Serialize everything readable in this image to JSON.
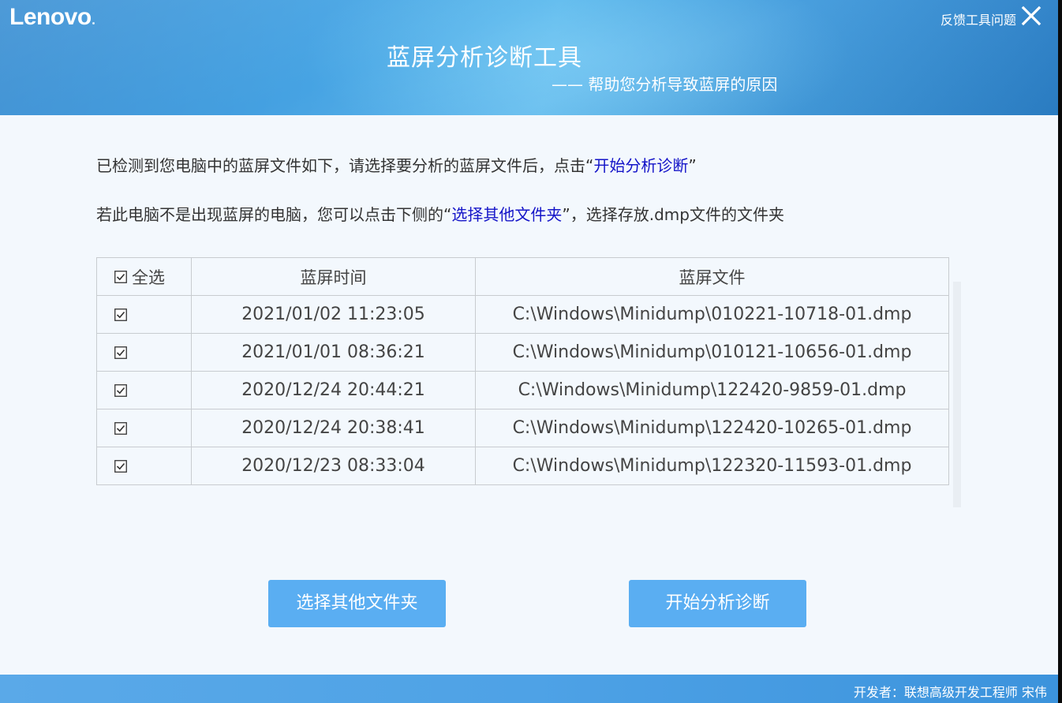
{
  "header": {
    "logo": "Lenovo",
    "feedback_label": "反馈工具问题",
    "title": "蓝屏分析诊断工具",
    "subtitle": "—— 帮助您分析导致蓝屏的原因"
  },
  "instructions": {
    "line1_prefix": "已检测到您电脑中的蓝屏文件如下，请选择要分析的蓝屏文件后，点击“",
    "line1_highlight": "开始分析诊断",
    "line1_suffix": "”",
    "line2_prefix": "若此电脑不是出现蓝屏的电脑，您可以点击下侧的“",
    "line2_highlight": "选择其他文件夹",
    "line2_suffix": "”，选择存放.dmp文件的文件夹"
  },
  "table": {
    "select_all_label": "全选",
    "select_all_checked": true,
    "columns": [
      "蓝屏时间",
      "蓝屏文件"
    ],
    "rows": [
      {
        "checked": true,
        "time": "2021/01/02 11:23:05",
        "file": "C:\\Windows\\Minidump\\010221-10718-01.dmp"
      },
      {
        "checked": true,
        "time": "2021/01/01 08:36:21",
        "file": "C:\\Windows\\Minidump\\010121-10656-01.dmp"
      },
      {
        "checked": true,
        "time": "2020/12/24 20:44:21",
        "file": "C:\\Windows\\Minidump\\122420-9859-01.dmp"
      },
      {
        "checked": true,
        "time": "2020/12/24 20:38:41",
        "file": "C:\\Windows\\Minidump\\122420-10265-01.dmp"
      },
      {
        "checked": true,
        "time": "2020/12/23 08:33:04",
        "file": "C:\\Windows\\Minidump\\122320-11593-01.dmp"
      }
    ]
  },
  "buttons": {
    "select_folder": "选择其他文件夹",
    "start_analysis": "开始分析诊断"
  },
  "footer": {
    "developer": "开发者：联想高级开发工程师 宋伟"
  },
  "colors": {
    "header_blue": "#3d98db",
    "highlight_text": "#1414c8",
    "button_blue": "#5aaef2",
    "background": "#f3f8fd"
  },
  "icons": {
    "close": "close-icon",
    "checkbox": "checkbox-checked-icon"
  }
}
